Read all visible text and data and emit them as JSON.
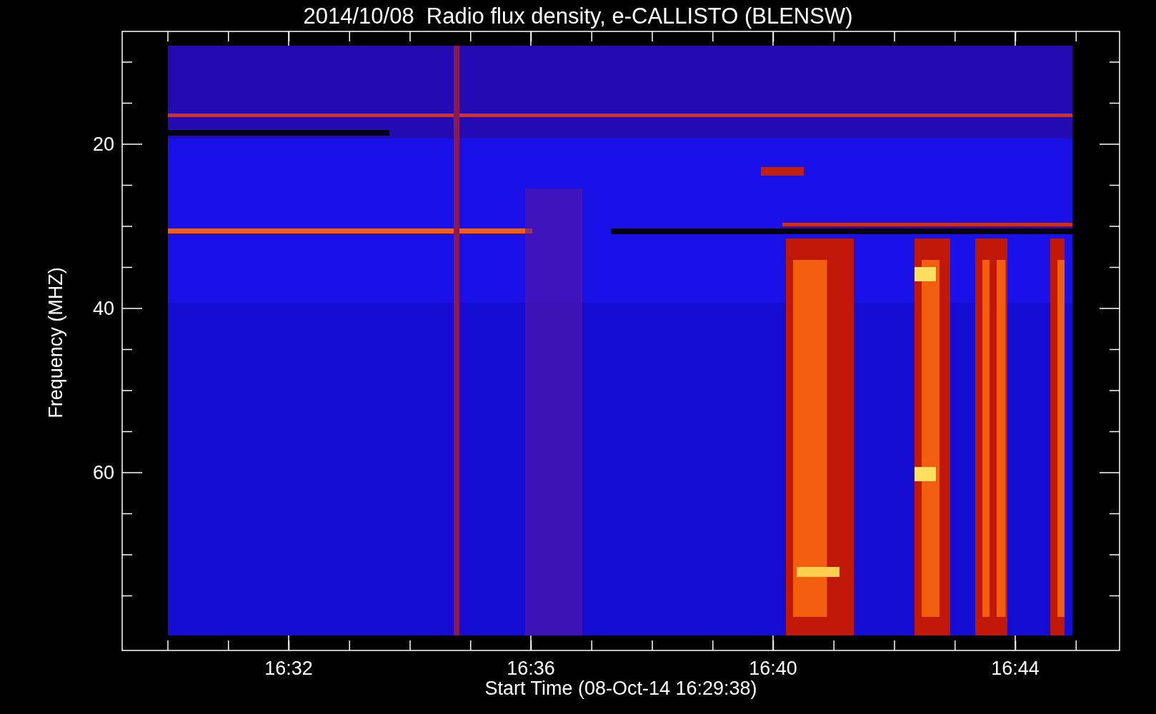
{
  "title": "2014/10/08  Radio flux density, e-CALLISTO (BLENSW)",
  "ylabel": "Frequency (MHZ)",
  "xlabel": "Start Time (08-Oct-14 16:29:38)",
  "y_tick_labels": [
    "20",
    "40",
    "60"
  ],
  "x_tick_labels": [
    "16:32",
    "16:36",
    "16:40",
    "16:44"
  ]
}
